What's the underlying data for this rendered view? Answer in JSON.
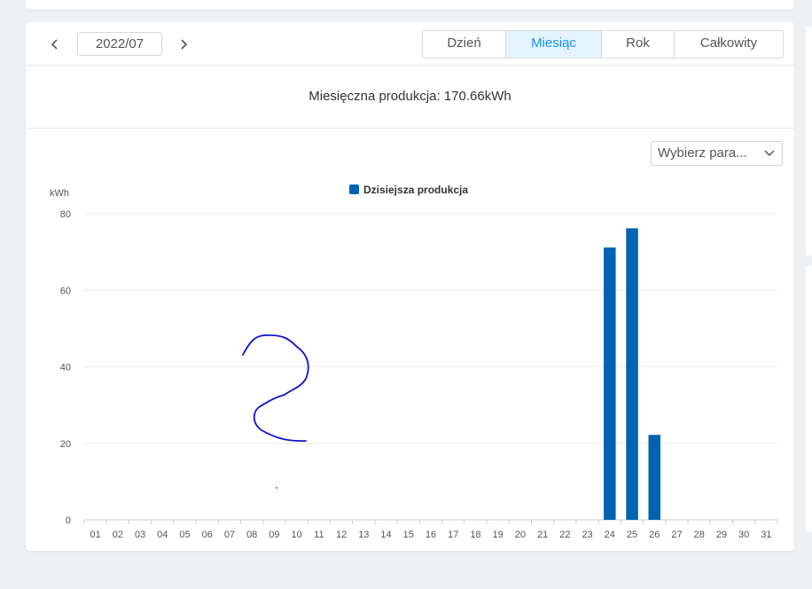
{
  "toolbar": {
    "prev_icon": "chevron-left-icon",
    "next_icon": "chevron-right-icon",
    "date": "2022/07",
    "tabs": [
      {
        "label": "Dzień",
        "active": false
      },
      {
        "label": "Miesiąc",
        "active": true
      },
      {
        "label": "Rok",
        "active": false
      },
      {
        "label": "Całkowity",
        "active": false
      }
    ]
  },
  "summary": {
    "text": "Miesięczna produkcja: 170.66kWh"
  },
  "param_select": {
    "value": "Wybierz para...",
    "icon": "chevron-down-icon"
  },
  "colors": {
    "accent": "#1890ff",
    "bar": "#0063b1",
    "annotation": "#1010d0"
  },
  "chart_data": {
    "type": "bar",
    "ylabel": "kWh",
    "xlabel": "",
    "ylim": [
      0,
      80
    ],
    "yticks": [
      0,
      20,
      40,
      60,
      80
    ],
    "grid": true,
    "legend_position": "top-center",
    "categories": [
      "01",
      "02",
      "03",
      "04",
      "05",
      "06",
      "07",
      "08",
      "09",
      "10",
      "11",
      "12",
      "13",
      "14",
      "15",
      "16",
      "17",
      "18",
      "19",
      "20",
      "21",
      "22",
      "23",
      "24",
      "25",
      "26",
      "27",
      "28",
      "29",
      "30",
      "31"
    ],
    "series": [
      {
        "name": "Dzisiejsza produkcja",
        "values": [
          0,
          0,
          0,
          0,
          0,
          0,
          0,
          0,
          0,
          0,
          0,
          0,
          0,
          0,
          0,
          0,
          0,
          0,
          0,
          0,
          0,
          0,
          0,
          71.2,
          76.2,
          22.2,
          0,
          0,
          0,
          0,
          0
        ]
      }
    ],
    "annotation": "hand-drawn digit 2"
  }
}
